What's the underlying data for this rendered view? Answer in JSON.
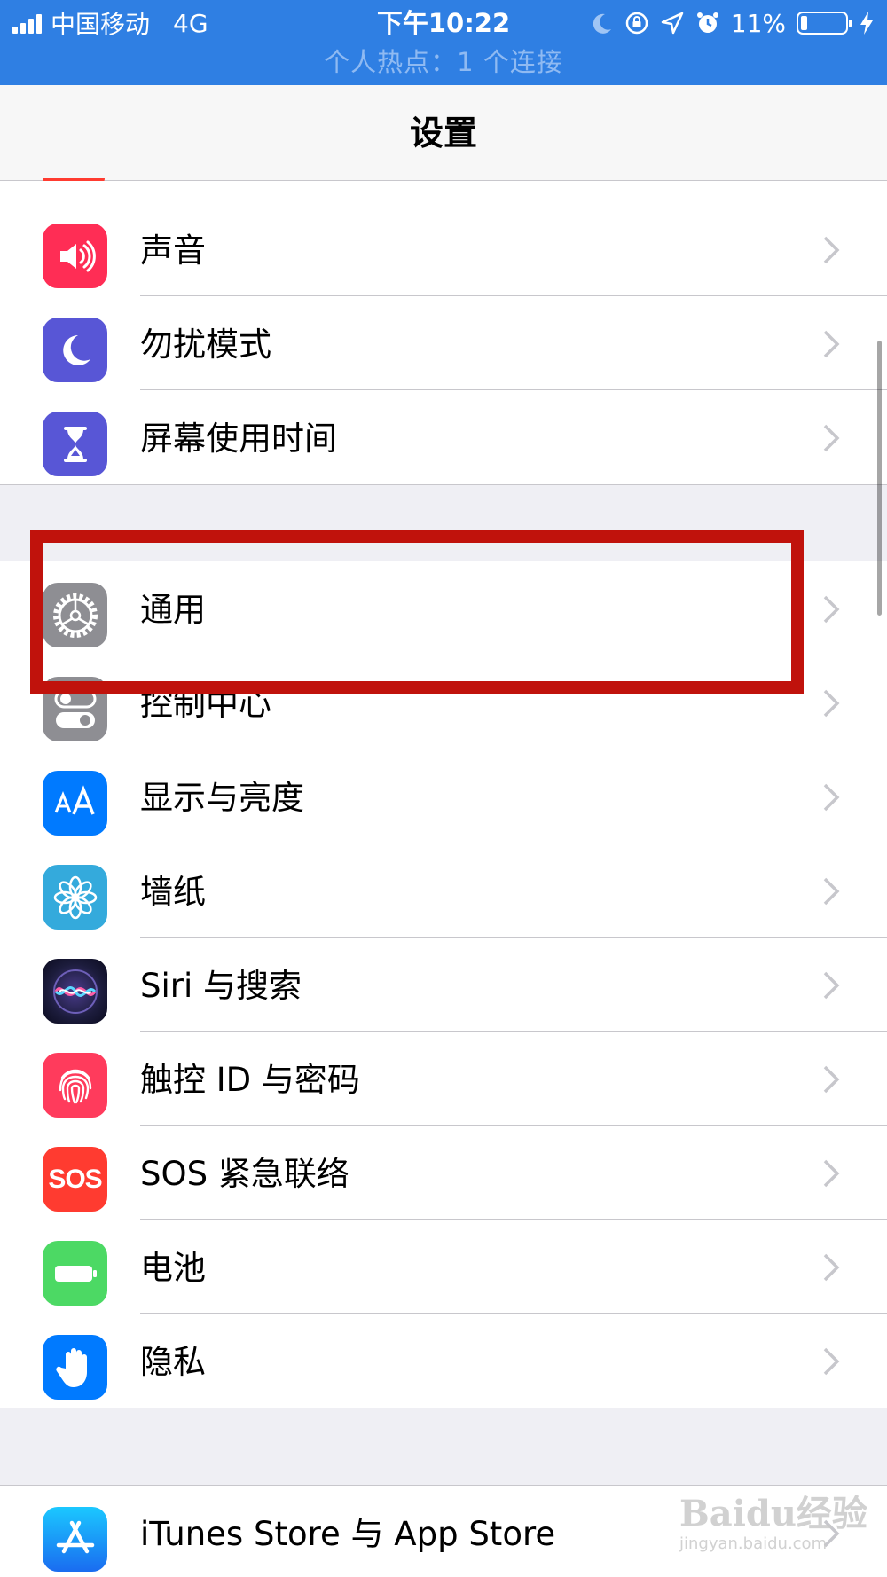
{
  "status_bar": {
    "carrier": "中国移动",
    "network": "4G",
    "time": "下午10:22",
    "battery_percent": "11%",
    "battery_level": 0.11,
    "hotspot_text": "个人热点：1 个连接",
    "icons": [
      "signal-icon",
      "moon-icon",
      "orientation-lock-icon",
      "location-icon",
      "alarm-icon",
      "battery-icon",
      "charging-icon"
    ],
    "background_color": "#2f7fe3"
  },
  "nav": {
    "title": "设置"
  },
  "groups": [
    {
      "items": [
        {
          "label": "声音",
          "icon": "sound-icon",
          "color": "#ff2d55"
        },
        {
          "label": "勿扰模式",
          "icon": "moon-icon",
          "color": "#5856d6"
        },
        {
          "label": "屏幕使用时间",
          "icon": "hourglass-icon",
          "color": "#5856d6"
        }
      ]
    },
    {
      "items": [
        {
          "label": "通用",
          "icon": "gear-icon",
          "color": "#8e8e93"
        },
        {
          "label": "控制中心",
          "icon": "toggle-icon",
          "color": "#8e8e93"
        },
        {
          "label": "显示与亮度",
          "icon": "text-size-icon",
          "color": "#007aff"
        },
        {
          "label": "墙纸",
          "icon": "flower-icon",
          "color": "#34aadc"
        },
        {
          "label": "Siri 与搜索",
          "icon": "siri-icon",
          "color": "#1c1c3c"
        },
        {
          "label": "触控 ID 与密码",
          "icon": "fingerprint-icon",
          "color": "#ff3b5c"
        },
        {
          "label": "SOS 紧急联络",
          "icon": "sos-icon",
          "color": "#ff3b30",
          "icon_text": "SOS"
        },
        {
          "label": "电池",
          "icon": "battery-icon",
          "color": "#4cd964"
        },
        {
          "label": "隐私",
          "icon": "hand-icon",
          "color": "#007aff"
        }
      ]
    },
    {
      "items": [
        {
          "label": "iTunes Store 与 App Store",
          "icon": "app-store-icon",
          "color": "#1a8cff"
        }
      ]
    }
  ],
  "highlight": {
    "target": "通用",
    "color": "#c0120c"
  },
  "watermark": {
    "main": "Baidu经验",
    "sub": "jingyan.baidu.com"
  }
}
